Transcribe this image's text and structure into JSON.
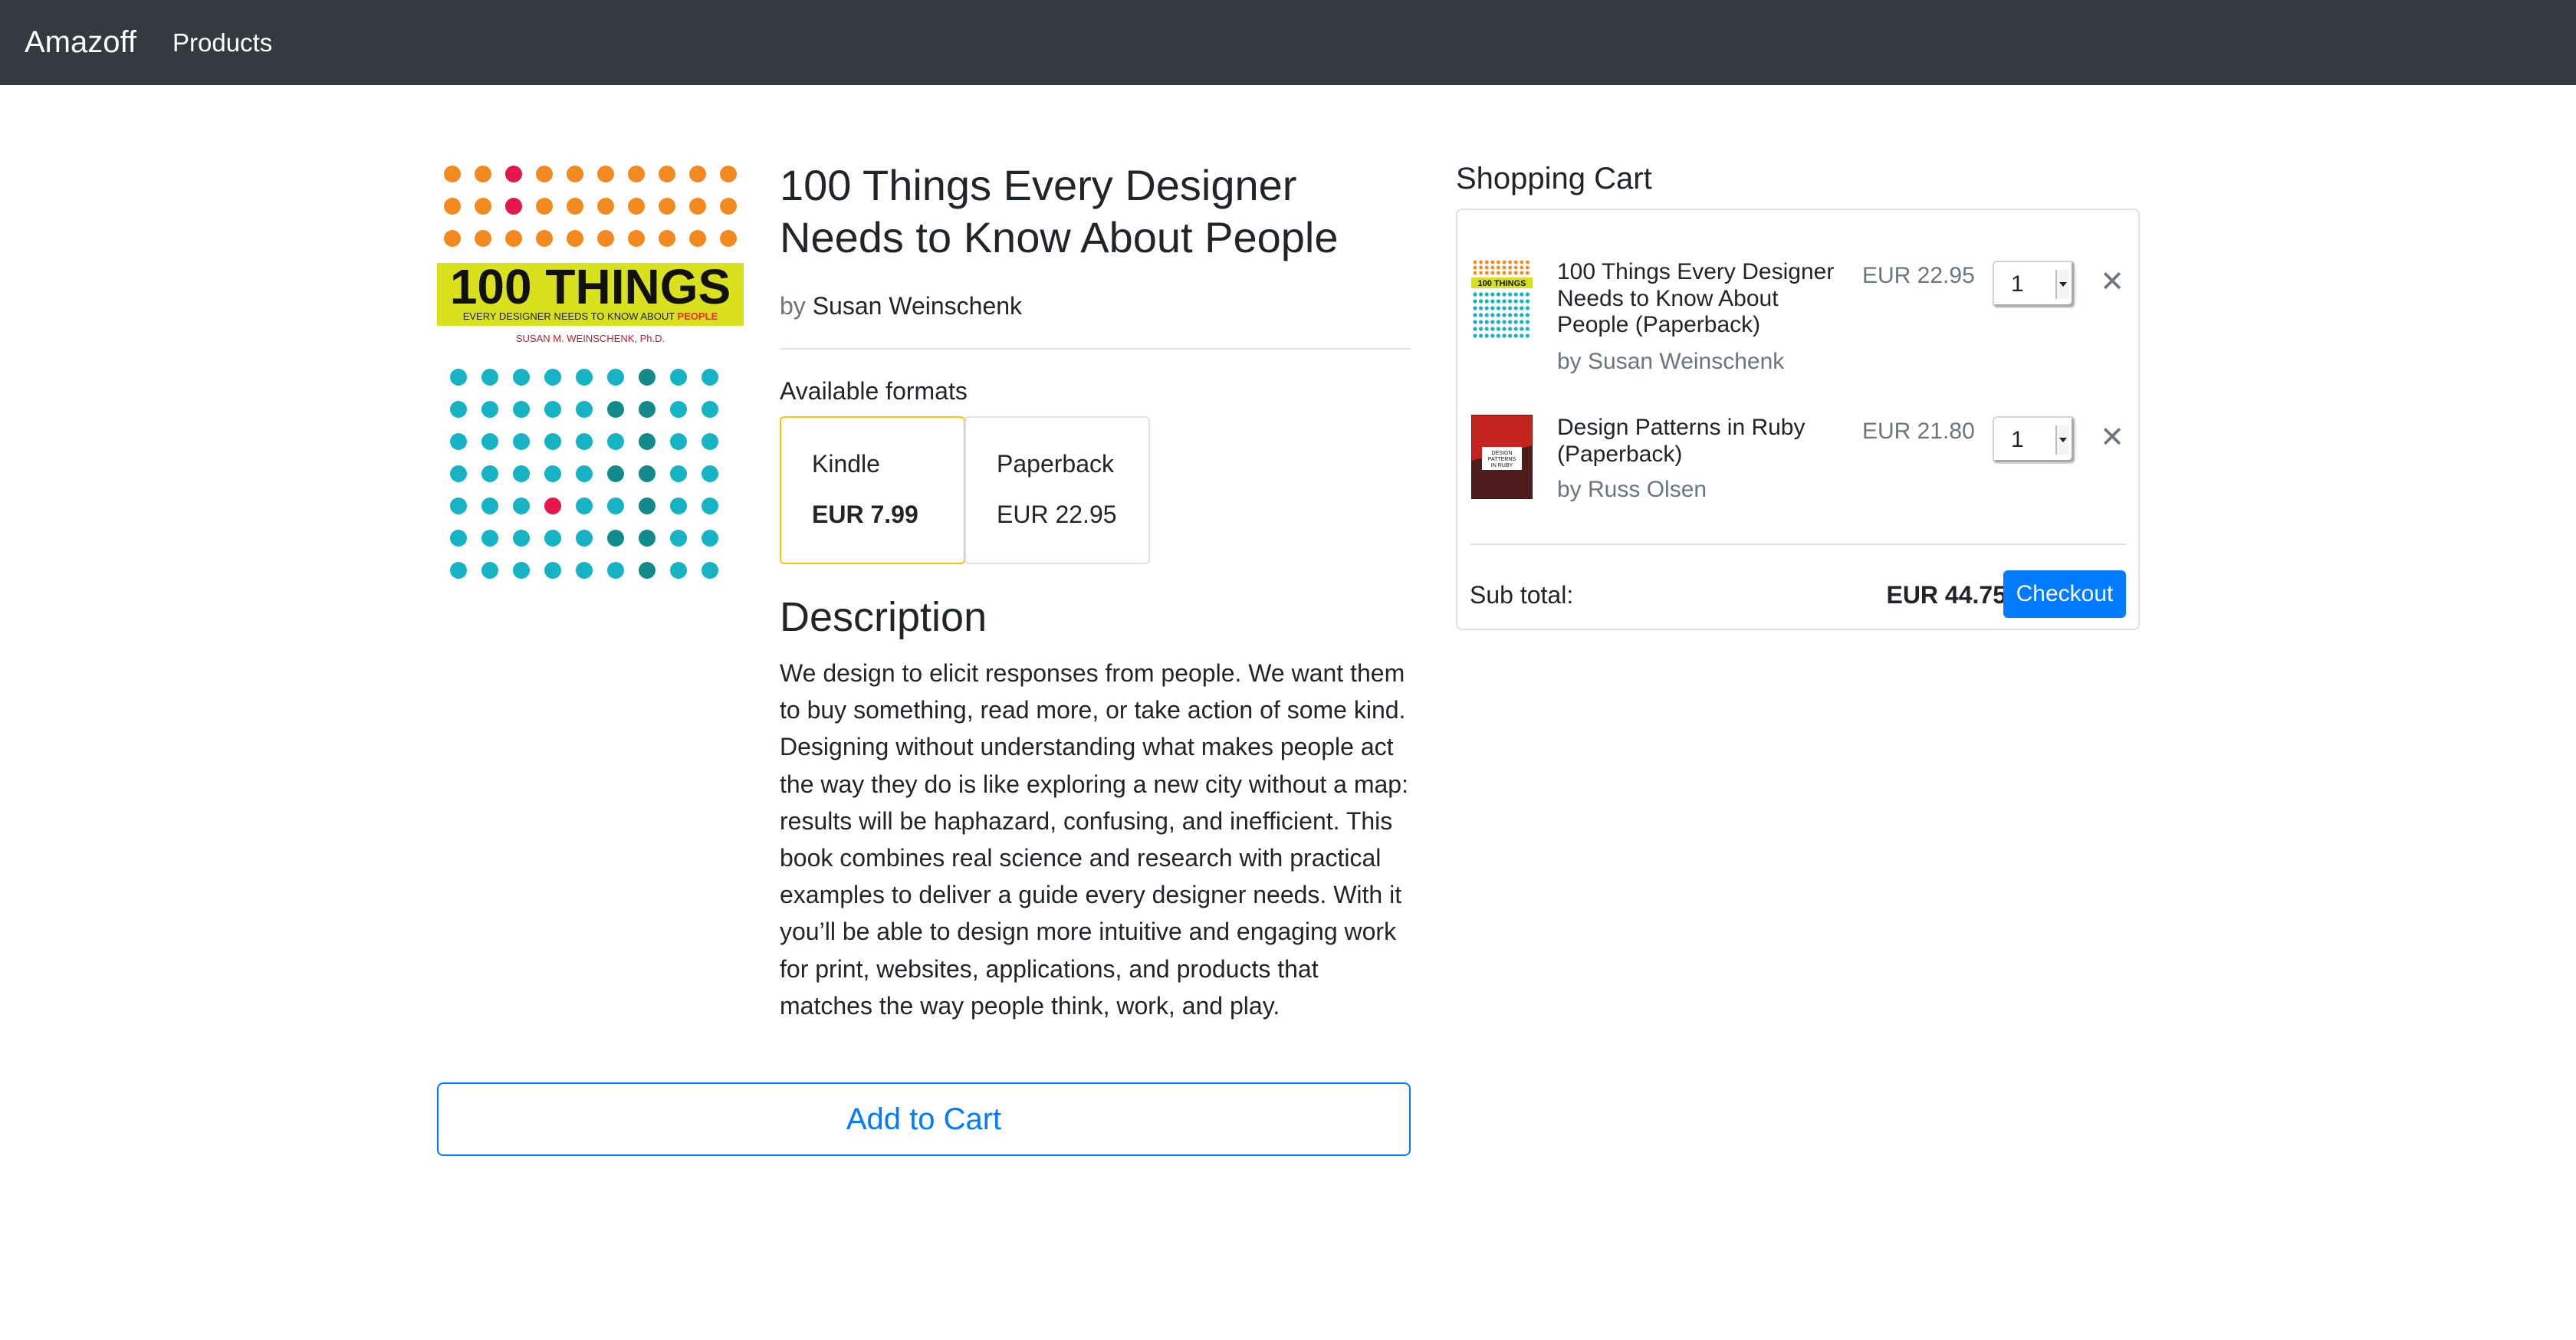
{
  "navbar": {
    "brand": "Amazoff",
    "links": [
      "Products"
    ]
  },
  "product": {
    "title": "100 Things Every Designer Needs to Know About People",
    "by_prefix": "by",
    "author": "Susan Weinschenk",
    "cover": {
      "big_text": "100 THINGS",
      "subtitle": "EVERY DESIGNER NEEDS TO KNOW ABOUT",
      "subtitle_highlight": "PEOPLE",
      "author_line": "SUSAN M. WEINSCHENK, Ph.D."
    },
    "formats_heading": "Available formats",
    "formats": [
      {
        "name": "Kindle",
        "price": "EUR 7.99",
        "selected": true
      },
      {
        "name": "Paperback",
        "price": "EUR 22.95",
        "selected": false
      }
    ],
    "description_heading": "Description",
    "description": "We design to elicit responses from people. We want them to buy something, read more, or take action of some kind. Designing without understanding what makes people act the way they do is like exploring a new city without a map: results will be haphazard, confusing, and inefficient. This book combines real science and research with practical examples to deliver a guide every designer needs. With it you’ll be able to design more intuitive and engaging work for print, websites, applications, and products that matches the way people think, work, and play.",
    "add_to_cart_label": "Add to Cart"
  },
  "cart": {
    "heading": "Shopping Cart",
    "items": [
      {
        "title": "100 Things Every Designer Needs to Know About People (Paperback)",
        "author": "by Susan Weinschenk",
        "price": "EUR 22.95",
        "quantity": "1",
        "remove_icon": "close-icon"
      },
      {
        "title": "Design Patterns in Ruby (Paperback)",
        "author": "by Russ Olsen",
        "price": "EUR 21.80",
        "quantity": "1",
        "remove_icon": "close-icon",
        "thumb_text": "DESIGN PATTERNS IN RUBY"
      }
    ],
    "subtotal_label": "Sub total:",
    "subtotal_value": "EUR 44.75",
    "checkout_label": "Checkout"
  },
  "colors": {
    "navbar_bg": "#343a40",
    "primary": "#007bff",
    "selected_border": "#ffc107",
    "muted": "#6c757d"
  }
}
